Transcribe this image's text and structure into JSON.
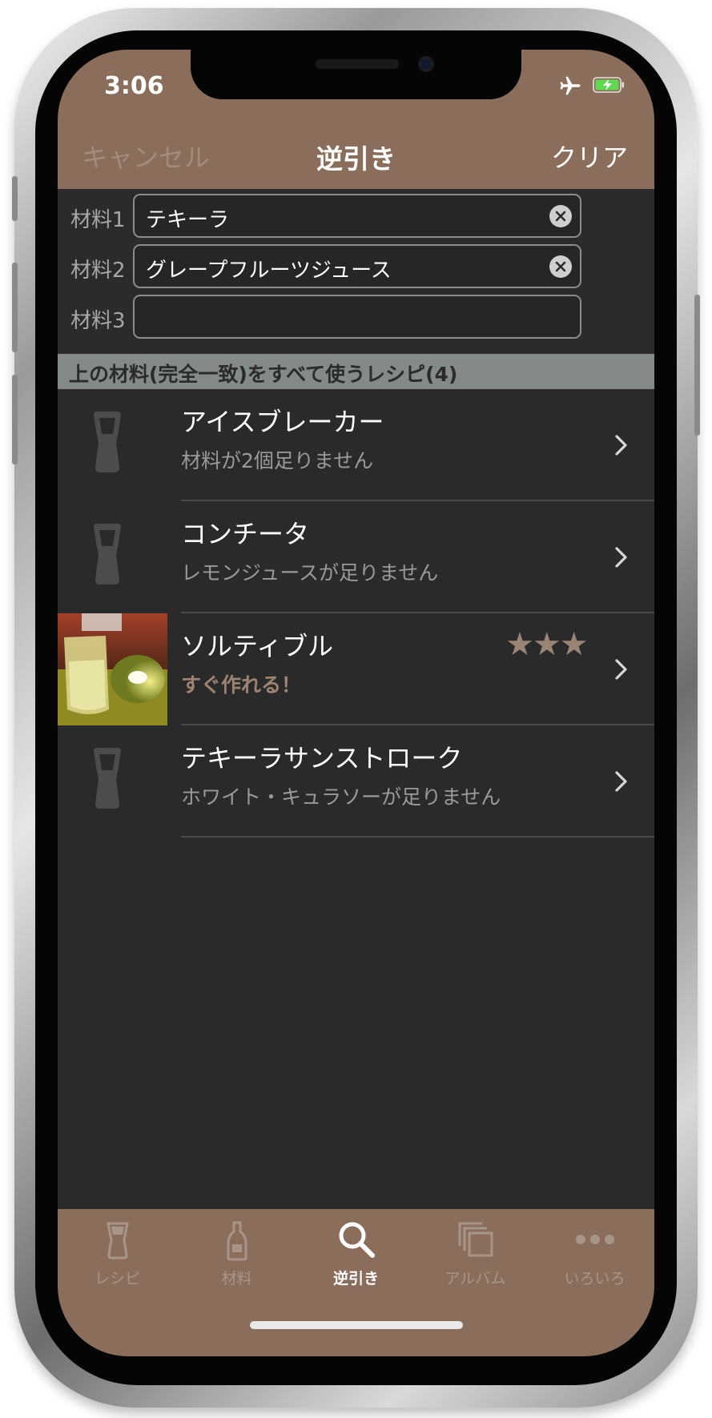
{
  "status_bar": {
    "time": "3:06"
  },
  "nav": {
    "cancel_label": "キャンセル",
    "title": "逆引き",
    "clear_label": "クリア"
  },
  "ingredients": [
    {
      "label": "材料1",
      "value": "テキーラ"
    },
    {
      "label": "材料2",
      "value": "グレープフルーツジュース"
    },
    {
      "label": "材料3",
      "value": ""
    }
  ],
  "section_header": "上の材料(完全一致)をすべて使うレシピ(4)",
  "recipes": [
    {
      "name": "アイスブレーカー",
      "detail": "材料が2個足りません",
      "has_photo": false,
      "stars": ""
    },
    {
      "name": "コンチータ",
      "detail": "レモンジュースが足りません",
      "has_photo": false,
      "stars": ""
    },
    {
      "name": "ソルティブル",
      "detail": "すぐ作れる！",
      "has_photo": true,
      "stars": "★★★"
    },
    {
      "name": "テキーラサンストローク",
      "detail": "ホワイト・キュラソーが足りません",
      "has_photo": false,
      "stars": ""
    }
  ],
  "tabs": [
    {
      "label": "レシピ",
      "icon": "glass-icon",
      "active": false
    },
    {
      "label": "材料",
      "icon": "bottle-icon",
      "active": false
    },
    {
      "label": "逆引き",
      "icon": "search-icon",
      "active": true
    },
    {
      "label": "アルバム",
      "icon": "album-icon",
      "active": false
    },
    {
      "label": "いろいろ",
      "icon": "more-icon",
      "active": false
    }
  ],
  "colors": {
    "accent": "#8a6e5b",
    "background": "#2a2a2a",
    "section_header": "#848989",
    "star": "#9a8475"
  }
}
